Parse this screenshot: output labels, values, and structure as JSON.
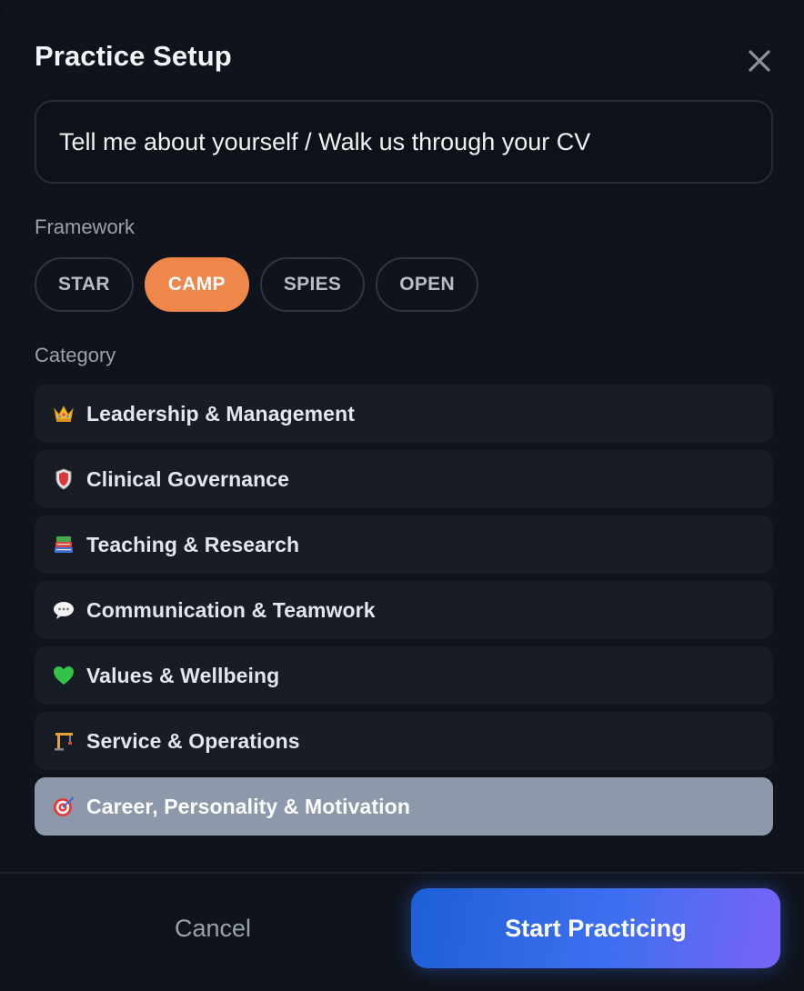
{
  "modal": {
    "title": "Practice Setup",
    "close_icon": "close-icon"
  },
  "question": {
    "text": "Tell me about yourself / Walk us through your CV"
  },
  "framework": {
    "label": "Framework",
    "options": [
      "STAR",
      "CAMP",
      "SPIES",
      "OPEN"
    ],
    "selected": "CAMP"
  },
  "category": {
    "label": "Category",
    "items": [
      {
        "label": "Leadership & Management",
        "icon": "crown-icon"
      },
      {
        "label": "Clinical Governance",
        "icon": "shield-icon"
      },
      {
        "label": "Teaching & Research",
        "icon": "books-icon"
      },
      {
        "label": "Communication & Teamwork",
        "icon": "speech-bubble-icon"
      },
      {
        "label": "Values & Wellbeing",
        "icon": "green-heart-icon"
      },
      {
        "label": "Service & Operations",
        "icon": "construction-crane-icon"
      },
      {
        "label": "Career, Personality & Motivation",
        "icon": "target-icon"
      }
    ],
    "selected": "Career, Personality & Motivation"
  },
  "footer": {
    "cancel_label": "Cancel",
    "start_label": "Start Practicing"
  },
  "colors": {
    "background": "#0f131b",
    "accent_orange": "#f0874a",
    "selected_category": "#8d99ab",
    "start_gradient_from": "#1d5fd6",
    "start_gradient_to": "#7a63f6"
  }
}
